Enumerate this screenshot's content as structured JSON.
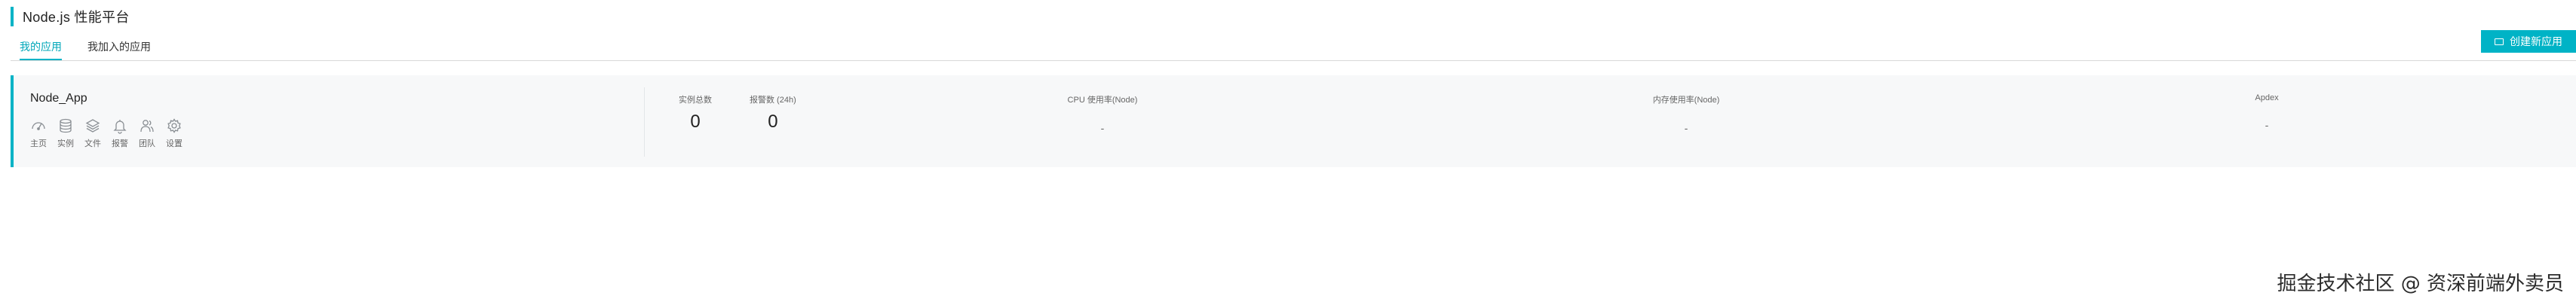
{
  "header": {
    "title": "Node.js 性能平台"
  },
  "tabs": [
    {
      "label": "我的应用",
      "active": true
    },
    {
      "label": "我加入的应用",
      "active": false
    }
  ],
  "toolbar": {
    "create_label": "创建新应用",
    "create_icon": "window-icon"
  },
  "app_card": {
    "name": "Node_App",
    "actions": [
      {
        "label": "主页",
        "icon": "dashboard-icon"
      },
      {
        "label": "实例",
        "icon": "database-icon"
      },
      {
        "label": "文件",
        "icon": "layers-icon"
      },
      {
        "label": "报警",
        "icon": "bell-icon"
      },
      {
        "label": "团队",
        "icon": "team-icon"
      },
      {
        "label": "设置",
        "icon": "gear-icon"
      }
    ],
    "stats": {
      "instances_label": "实例总数",
      "instances_value": "0",
      "alarms_label": "报警数 (24h)",
      "alarms_value": "0"
    },
    "metrics": {
      "cpu_label": "CPU 使用率(Node)",
      "cpu_value": "-",
      "memory_label": "内存使用率(Node)",
      "memory_value": "-",
      "apdex_label": "Apdex",
      "apdex_value": "-"
    }
  },
  "watermark": "掘金技术社区 @ 资深前端外卖员",
  "colors": {
    "accent": "#00b3c6",
    "card_bg": "#f7f8f9",
    "divider": "#d9d9d9"
  }
}
